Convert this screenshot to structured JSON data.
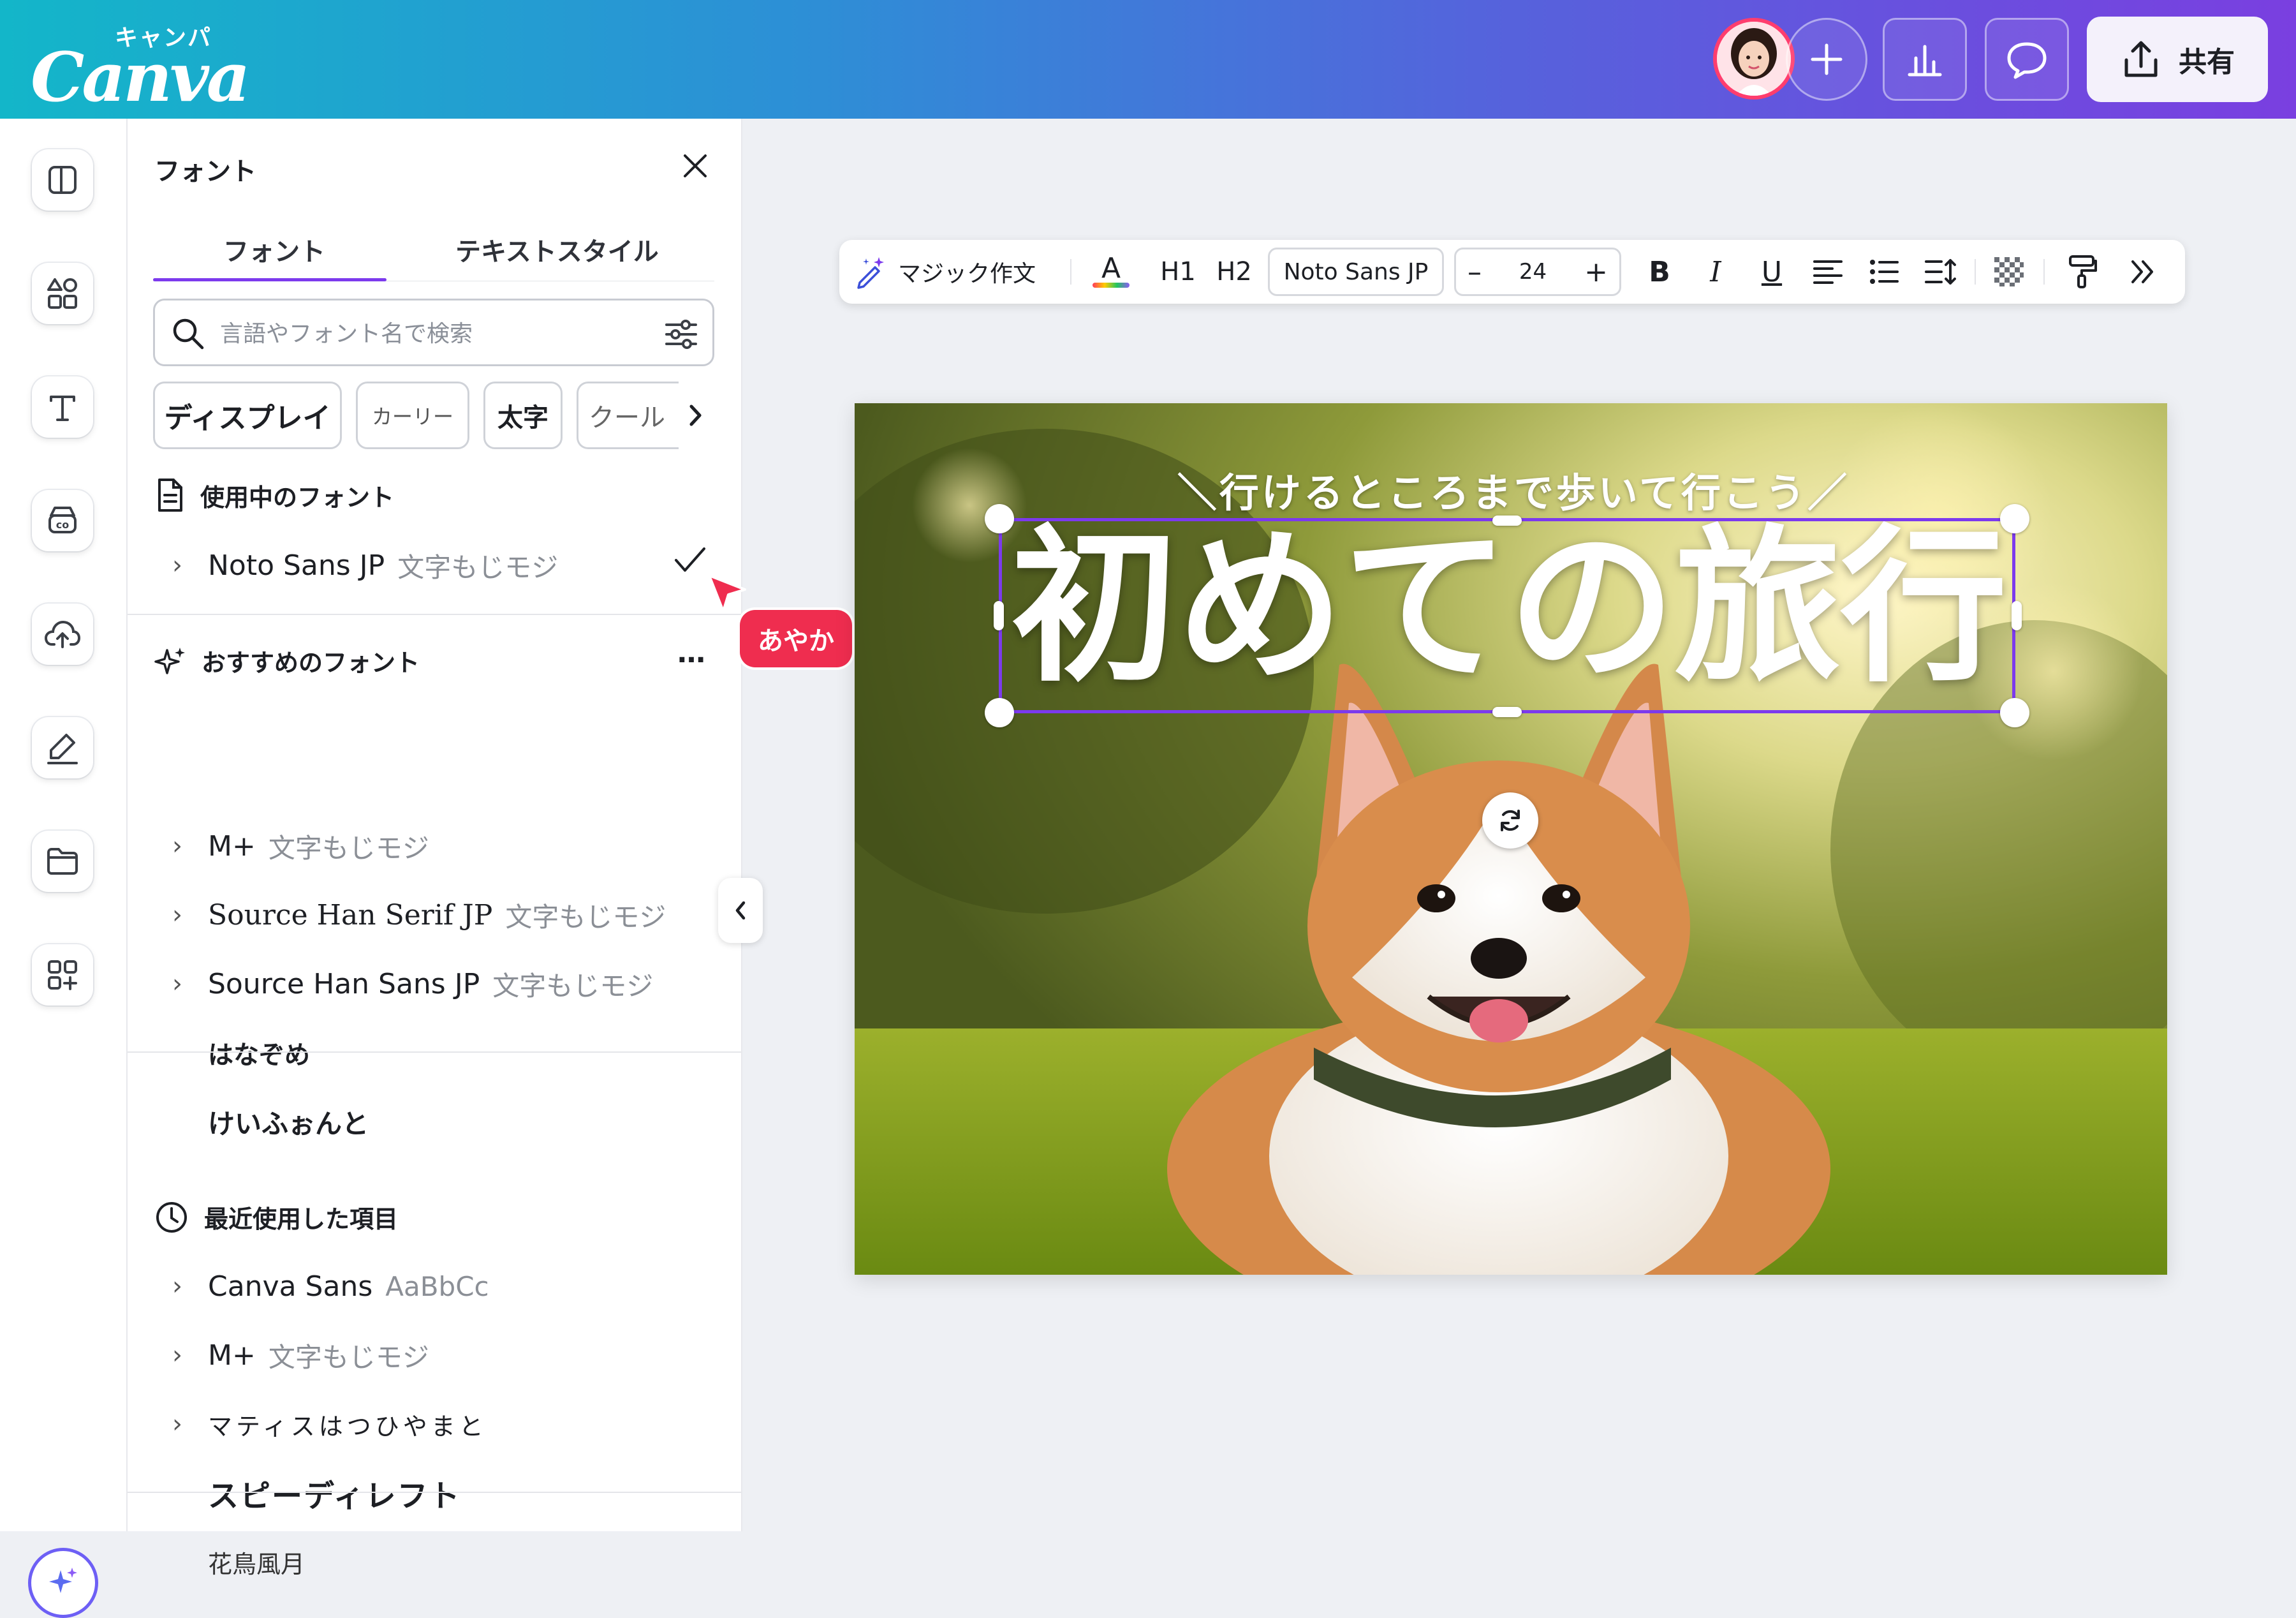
{
  "header": {
    "logo_jp": "キャンパ",
    "logo_en": "Canva",
    "share_label": "共有",
    "icons": [
      "avatar",
      "plus-icon",
      "insights-icon",
      "comment-icon",
      "share-upload-icon"
    ]
  },
  "rail": {
    "icons": [
      "design-icon",
      "elements-icon",
      "text-icon",
      "brand-icon",
      "uploads-icon",
      "draw-icon",
      "projects-icon",
      "apps-icon",
      "magic-icon"
    ]
  },
  "panel": {
    "title": "フォント",
    "tabs": [
      {
        "label": "フォント",
        "active": true
      },
      {
        "label": "テキストスタイル",
        "active": false
      }
    ],
    "search_placeholder": "言語やフォント名で検索",
    "chips": [
      "ディスプレイ",
      "カーリー",
      "太字",
      "クール"
    ],
    "in_use": {
      "heading": "使用中のフォント",
      "items": [
        {
          "name": "Noto Sans JP",
          "sample": "文字もじモジ",
          "selected": true
        }
      ]
    },
    "recommended": {
      "heading": "おすすめのフォント",
      "more": "…",
      "items": [
        {
          "name": "M+",
          "sample": "文字もじモジ"
        },
        {
          "name": "Source Han Serif JP",
          "sample": "文字もじモジ"
        },
        {
          "name": "Source Han Sans JP",
          "sample": "文字もじモジ"
        },
        {
          "name": "はなぞめ"
        },
        {
          "name": "けいふぉんと"
        }
      ]
    },
    "recent": {
      "heading": "最近使用した項目",
      "items": [
        {
          "name": "Canva Sans",
          "sample": "AaBbCc"
        },
        {
          "name": "M+",
          "sample": "文字もじモジ"
        },
        {
          "name": "マティスはつひやまと"
        },
        {
          "name": "スピーディレフト"
        },
        {
          "name": "花鳥風月"
        }
      ]
    }
  },
  "collaborator": {
    "name": "あやか",
    "color": "#ef2d4f"
  },
  "toolbar": {
    "magic_write": "マジック作文",
    "text_color_glyph": "A",
    "h1": "H1",
    "h2": "H2",
    "font_name": "Noto Sans JP",
    "font_size": "24",
    "minus": "–",
    "plus": "+",
    "bold": "B",
    "italic": "I",
    "underline": "U"
  },
  "design": {
    "subtitle": "＼行けるところまで歩いて行こう／",
    "headline": "初めての旅行"
  },
  "colors": {
    "accent": "#7c3aed",
    "header_start": "#13b6c9",
    "header_end": "#7a3fe0"
  }
}
